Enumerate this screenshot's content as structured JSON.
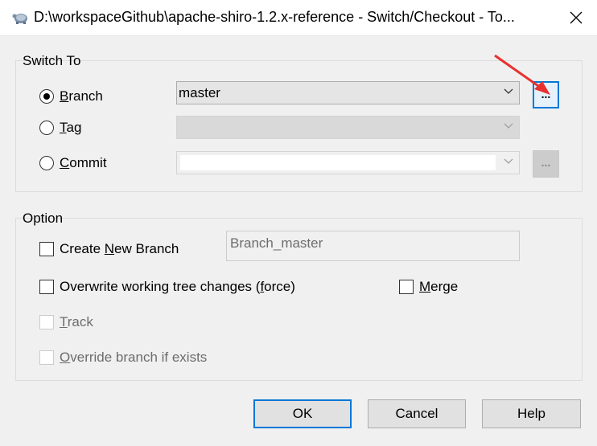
{
  "window": {
    "title": "D:\\workspaceGithub\\apache-shiro-1.2.x-reference - Switch/Checkout - To...",
    "icon": "tortoisegit-turtle-icon"
  },
  "switch_to": {
    "group_label": "Switch To",
    "options": [
      {
        "label_u": "B",
        "label_rest": "ranch",
        "checked": true
      },
      {
        "label_u": "T",
        "label_rest": "ag",
        "checked": false
      },
      {
        "label_u": "C",
        "label_rest": "ommit",
        "checked": false
      }
    ],
    "branch_value": "master",
    "tag_value": "",
    "commit_value": "",
    "browse_label": "..."
  },
  "option": {
    "group_label": "Option",
    "create_new_branch": {
      "pre": "Create ",
      "u": "N",
      "post": "ew Branch",
      "checked": false
    },
    "new_branch_name": "Branch_master",
    "overwrite": {
      "pre": "Overwrite working tree changes (",
      "u": "f",
      "post": "orce)",
      "checked": false
    },
    "merge": {
      "u": "M",
      "post": "erge",
      "checked": false
    },
    "track": {
      "pre": "",
      "u": "T",
      "post": "rack",
      "checked": false,
      "disabled": true
    },
    "override": {
      "pre": "",
      "u": "O",
      "post": "verride branch if exists",
      "checked": false,
      "disabled": true
    }
  },
  "buttons": {
    "ok": "OK",
    "cancel": "Cancel",
    "help": "Help"
  },
  "colors": {
    "focus_blue": "#0078d7",
    "annotation_arrow": "#e8312f"
  }
}
